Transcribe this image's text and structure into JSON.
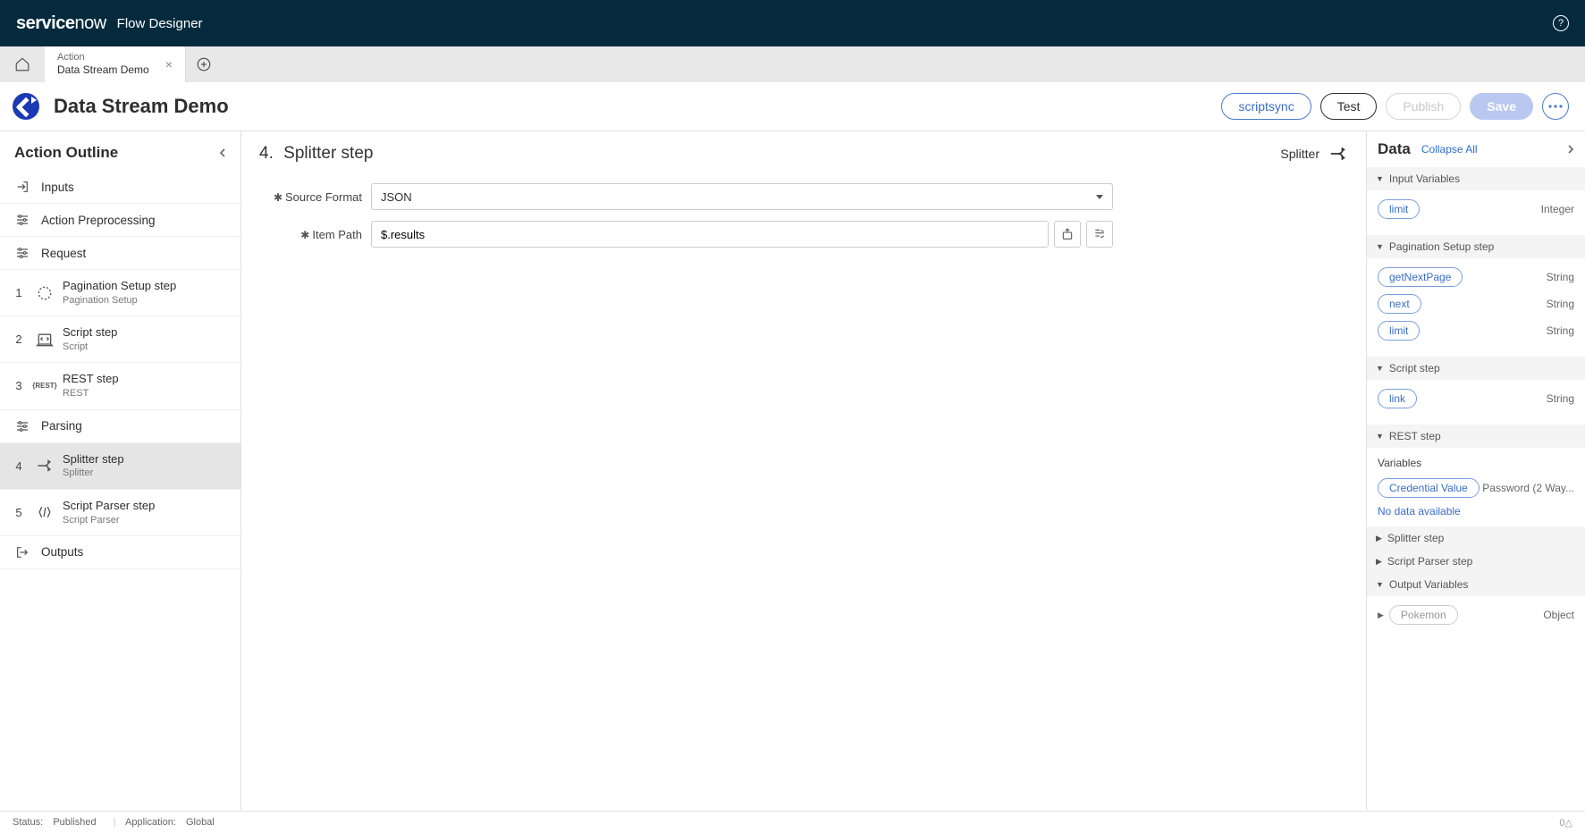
{
  "brand": {
    "service": "service",
    "now": "now",
    "app": "Flow Designer"
  },
  "tab": {
    "type": "Action",
    "title": "Data Stream Demo"
  },
  "page": {
    "title": "Data Stream Demo"
  },
  "actions": {
    "scriptsync": "scriptsync",
    "test": "Test",
    "publish": "Publish",
    "save": "Save"
  },
  "sidebar": {
    "heading": "Action Outline",
    "inputs": "Inputs",
    "preprocessing": "Action Preprocessing",
    "request": "Request",
    "parsing": "Parsing",
    "outputs": "Outputs",
    "steps": [
      {
        "n": "1",
        "title": "Pagination Setup step",
        "sub": "Pagination Setup"
      },
      {
        "n": "2",
        "title": "Script step",
        "sub": "Script"
      },
      {
        "n": "3",
        "title": "REST step",
        "sub": "REST"
      },
      {
        "n": "4",
        "title": "Splitter step",
        "sub": "Splitter"
      },
      {
        "n": "5",
        "title": "Script Parser step",
        "sub": "Script Parser"
      }
    ]
  },
  "center": {
    "heading_num": "4.",
    "heading_title": "Splitter step",
    "type_label": "Splitter",
    "source_format_label": "Source Format",
    "source_format_value": "JSON",
    "item_path_label": "Item Path",
    "item_path_value": "$.results"
  },
  "rp": {
    "heading": "Data",
    "collapse_all": "Collapse All",
    "sec_input": "Input Variables",
    "input_vars": [
      {
        "name": "limit",
        "type": "Integer"
      }
    ],
    "sec_pagination": "Pagination Setup step",
    "pagination_vars": [
      {
        "name": "getNextPage",
        "type": "String"
      },
      {
        "name": "next",
        "type": "String"
      },
      {
        "name": "limit",
        "type": "String"
      }
    ],
    "sec_script": "Script step",
    "script_vars": [
      {
        "name": "link",
        "type": "String"
      }
    ],
    "sec_rest": "REST step",
    "rest_sub": "Variables",
    "rest_vars": [
      {
        "name": "Credential Value",
        "type": "Password (2 Way..."
      }
    ],
    "rest_nodata": "No data available",
    "sec_splitter": "Splitter step",
    "sec_parser": "Script Parser step",
    "sec_output": "Output Variables",
    "output_vars": [
      {
        "name": "Pokemon",
        "type": "Object"
      }
    ]
  },
  "footer": {
    "status_label": "Status:",
    "status_value": "Published",
    "app_label": "Application:",
    "app_value": "Global",
    "right": "0△"
  }
}
